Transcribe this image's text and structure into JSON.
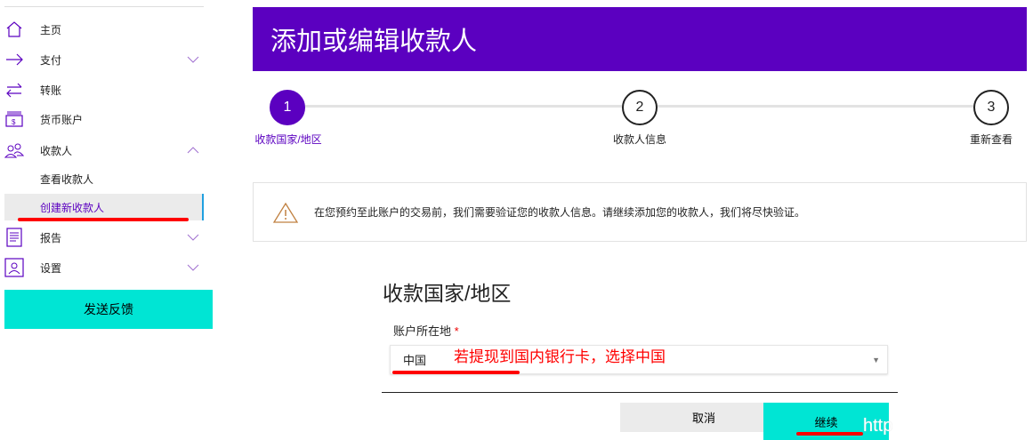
{
  "sidebar": {
    "items": [
      {
        "label": "主页",
        "icon": "home-icon"
      },
      {
        "label": "支付",
        "icon": "arrow-right-icon"
      },
      {
        "label": "转账",
        "icon": "transfer-icon"
      },
      {
        "label": "货币账户",
        "icon": "currency-account-icon"
      },
      {
        "label": "收款人",
        "icon": "payees-icon"
      },
      {
        "label": "报告",
        "icon": "report-icon"
      },
      {
        "label": "设置",
        "icon": "settings-icon"
      }
    ],
    "sub_items": [
      "查看收款人",
      "创建新收款人"
    ],
    "feedback": "发送反馈"
  },
  "header": {
    "title": "添加或编辑收款人"
  },
  "stepper": [
    {
      "num": "1",
      "label": "收款国家/地区"
    },
    {
      "num": "2",
      "label": "收款人信息"
    },
    {
      "num": "3",
      "label": "重新查看"
    }
  ],
  "warning": "在您预约至此账户的交易前，我们需要验证您的收款人信息。请继续添加您的收款人，我们将尽快验证。",
  "form": {
    "heading": "收款国家/地区",
    "field_label": "账户所在地",
    "required": "*",
    "value": "中国",
    "annotation": "若提现到国内银行卡，选择中国"
  },
  "buttons": {
    "cancel": "取消",
    "continue": "继续"
  },
  "watermark": "http",
  "colors": {
    "brand": "#5b00c0",
    "accent": "#00e5d4",
    "annotation": "#ff0000"
  }
}
